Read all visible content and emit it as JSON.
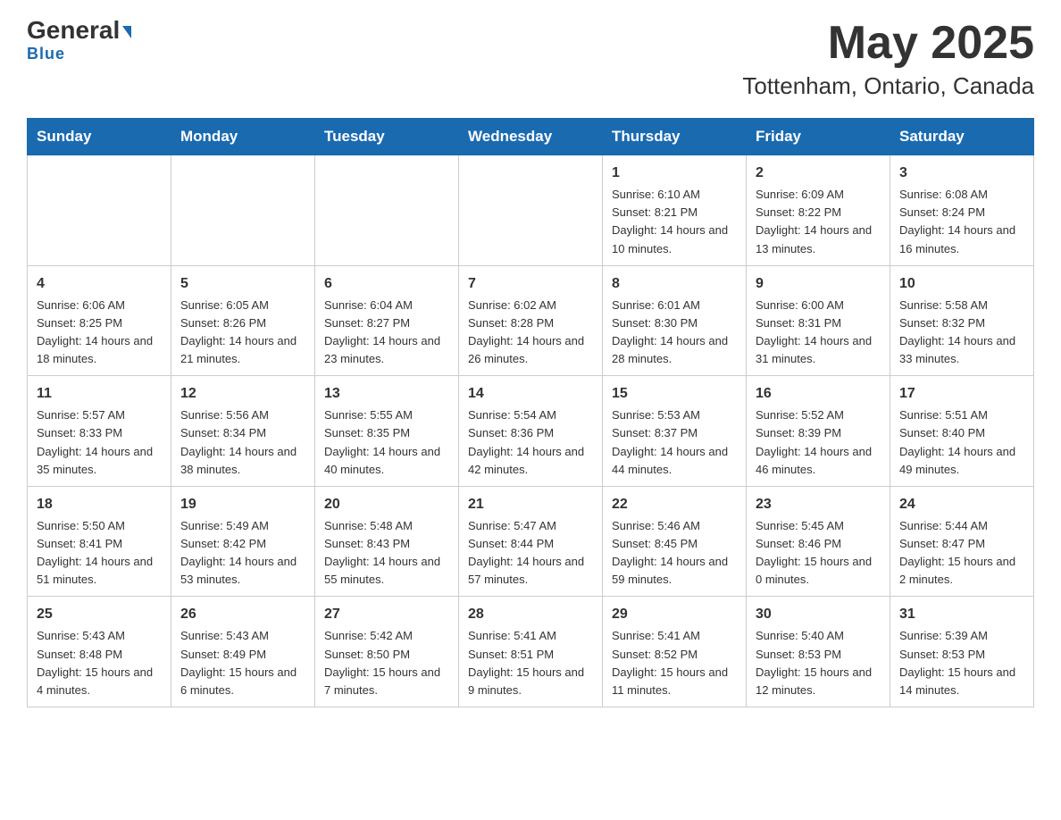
{
  "header": {
    "logo_general": "General",
    "logo_blue": "Blue",
    "title": "May 2025",
    "subtitle": "Tottenham, Ontario, Canada"
  },
  "weekdays": [
    "Sunday",
    "Monday",
    "Tuesday",
    "Wednesday",
    "Thursday",
    "Friday",
    "Saturday"
  ],
  "weeks": [
    [
      {
        "day": "",
        "info": ""
      },
      {
        "day": "",
        "info": ""
      },
      {
        "day": "",
        "info": ""
      },
      {
        "day": "",
        "info": ""
      },
      {
        "day": "1",
        "info": "Sunrise: 6:10 AM\nSunset: 8:21 PM\nDaylight: 14 hours and 10 minutes."
      },
      {
        "day": "2",
        "info": "Sunrise: 6:09 AM\nSunset: 8:22 PM\nDaylight: 14 hours and 13 minutes."
      },
      {
        "day": "3",
        "info": "Sunrise: 6:08 AM\nSunset: 8:24 PM\nDaylight: 14 hours and 16 minutes."
      }
    ],
    [
      {
        "day": "4",
        "info": "Sunrise: 6:06 AM\nSunset: 8:25 PM\nDaylight: 14 hours and 18 minutes."
      },
      {
        "day": "5",
        "info": "Sunrise: 6:05 AM\nSunset: 8:26 PM\nDaylight: 14 hours and 21 minutes."
      },
      {
        "day": "6",
        "info": "Sunrise: 6:04 AM\nSunset: 8:27 PM\nDaylight: 14 hours and 23 minutes."
      },
      {
        "day": "7",
        "info": "Sunrise: 6:02 AM\nSunset: 8:28 PM\nDaylight: 14 hours and 26 minutes."
      },
      {
        "day": "8",
        "info": "Sunrise: 6:01 AM\nSunset: 8:30 PM\nDaylight: 14 hours and 28 minutes."
      },
      {
        "day": "9",
        "info": "Sunrise: 6:00 AM\nSunset: 8:31 PM\nDaylight: 14 hours and 31 minutes."
      },
      {
        "day": "10",
        "info": "Sunrise: 5:58 AM\nSunset: 8:32 PM\nDaylight: 14 hours and 33 minutes."
      }
    ],
    [
      {
        "day": "11",
        "info": "Sunrise: 5:57 AM\nSunset: 8:33 PM\nDaylight: 14 hours and 35 minutes."
      },
      {
        "day": "12",
        "info": "Sunrise: 5:56 AM\nSunset: 8:34 PM\nDaylight: 14 hours and 38 minutes."
      },
      {
        "day": "13",
        "info": "Sunrise: 5:55 AM\nSunset: 8:35 PM\nDaylight: 14 hours and 40 minutes."
      },
      {
        "day": "14",
        "info": "Sunrise: 5:54 AM\nSunset: 8:36 PM\nDaylight: 14 hours and 42 minutes."
      },
      {
        "day": "15",
        "info": "Sunrise: 5:53 AM\nSunset: 8:37 PM\nDaylight: 14 hours and 44 minutes."
      },
      {
        "day": "16",
        "info": "Sunrise: 5:52 AM\nSunset: 8:39 PM\nDaylight: 14 hours and 46 minutes."
      },
      {
        "day": "17",
        "info": "Sunrise: 5:51 AM\nSunset: 8:40 PM\nDaylight: 14 hours and 49 minutes."
      }
    ],
    [
      {
        "day": "18",
        "info": "Sunrise: 5:50 AM\nSunset: 8:41 PM\nDaylight: 14 hours and 51 minutes."
      },
      {
        "day": "19",
        "info": "Sunrise: 5:49 AM\nSunset: 8:42 PM\nDaylight: 14 hours and 53 minutes."
      },
      {
        "day": "20",
        "info": "Sunrise: 5:48 AM\nSunset: 8:43 PM\nDaylight: 14 hours and 55 minutes."
      },
      {
        "day": "21",
        "info": "Sunrise: 5:47 AM\nSunset: 8:44 PM\nDaylight: 14 hours and 57 minutes."
      },
      {
        "day": "22",
        "info": "Sunrise: 5:46 AM\nSunset: 8:45 PM\nDaylight: 14 hours and 59 minutes."
      },
      {
        "day": "23",
        "info": "Sunrise: 5:45 AM\nSunset: 8:46 PM\nDaylight: 15 hours and 0 minutes."
      },
      {
        "day": "24",
        "info": "Sunrise: 5:44 AM\nSunset: 8:47 PM\nDaylight: 15 hours and 2 minutes."
      }
    ],
    [
      {
        "day": "25",
        "info": "Sunrise: 5:43 AM\nSunset: 8:48 PM\nDaylight: 15 hours and 4 minutes."
      },
      {
        "day": "26",
        "info": "Sunrise: 5:43 AM\nSunset: 8:49 PM\nDaylight: 15 hours and 6 minutes."
      },
      {
        "day": "27",
        "info": "Sunrise: 5:42 AM\nSunset: 8:50 PM\nDaylight: 15 hours and 7 minutes."
      },
      {
        "day": "28",
        "info": "Sunrise: 5:41 AM\nSunset: 8:51 PM\nDaylight: 15 hours and 9 minutes."
      },
      {
        "day": "29",
        "info": "Sunrise: 5:41 AM\nSunset: 8:52 PM\nDaylight: 15 hours and 11 minutes."
      },
      {
        "day": "30",
        "info": "Sunrise: 5:40 AM\nSunset: 8:53 PM\nDaylight: 15 hours and 12 minutes."
      },
      {
        "day": "31",
        "info": "Sunrise: 5:39 AM\nSunset: 8:53 PM\nDaylight: 15 hours and 14 minutes."
      }
    ]
  ]
}
